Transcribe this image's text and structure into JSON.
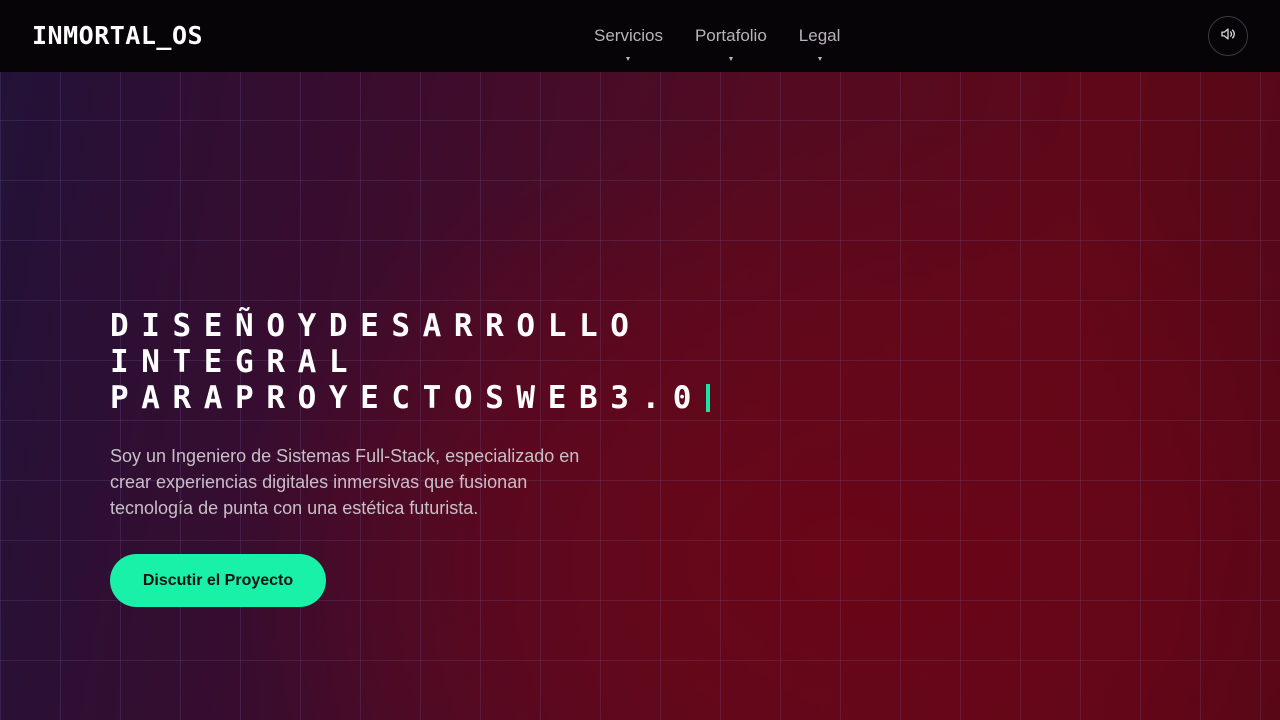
{
  "header": {
    "logo": "INMORTAL_OS",
    "nav": [
      {
        "label": "Servicios"
      },
      {
        "label": "Portafolio"
      },
      {
        "label": "Legal"
      }
    ],
    "sound_icon": "volume-icon"
  },
  "hero": {
    "title_lines": [
      "DISEÑOYDESARROLLO",
      "INTEGRAL",
      "PARAPROYECTOSWEB3.0"
    ],
    "description": "Soy un Ingeniero de Sistemas Full-Stack, especializado en crear experiencias digitales inmersivas que fusionan tecnología de punta con una estética futurista.",
    "cta_label": "Discutir el Proyecto"
  },
  "colors": {
    "accent": "#19f0a8",
    "header_bg": "#060406",
    "hero_bg_left": "#221238",
    "hero_bg_right": "#5f0819"
  }
}
